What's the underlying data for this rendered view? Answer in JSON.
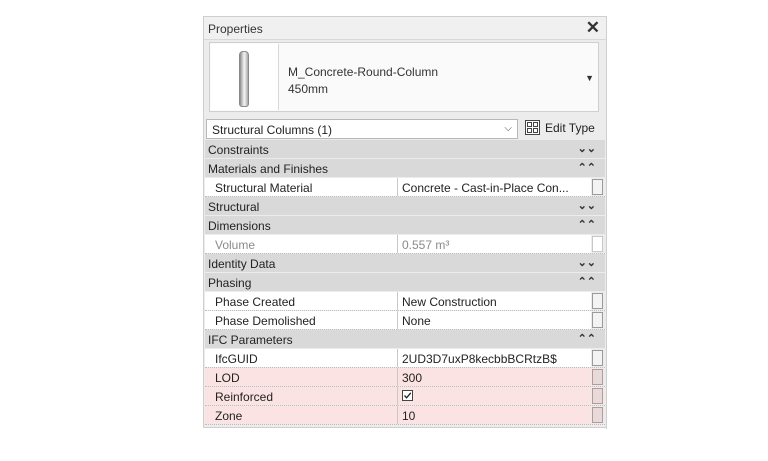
{
  "panel": {
    "title": "Properties",
    "close_glyph": "✕"
  },
  "type_selector": {
    "name": "M_Concrete-Round-Column",
    "size": "450mm",
    "dropdown_glyph": "▼",
    "thumbnail_icon": "round-column-preview-icon"
  },
  "category": {
    "label": "Structural Columns (1)",
    "chevron": "⌵"
  },
  "edit_type": {
    "label": "Edit Type",
    "icon": "edit-type-icon"
  },
  "rows": [
    {
      "kind": "group",
      "label": "Constraints",
      "toggle": "expand",
      "glyph": "⌄⌄"
    },
    {
      "kind": "group",
      "label": "Materials and Finishes",
      "toggle": "collapse",
      "glyph": "⌃⌃"
    },
    {
      "kind": "prop",
      "name": "Structural Material",
      "value": "Concrete - Cast-in-Place Con...",
      "editable": true
    },
    {
      "kind": "group",
      "label": "Structural",
      "toggle": "expand",
      "glyph": "⌄⌄"
    },
    {
      "kind": "group",
      "label": "Dimensions",
      "toggle": "collapse",
      "glyph": "⌃⌃"
    },
    {
      "kind": "prop",
      "name": "Volume",
      "value": "0.557 m³",
      "greyed": true
    },
    {
      "kind": "group",
      "label": "Identity Data",
      "toggle": "expand",
      "glyph": "⌄⌄"
    },
    {
      "kind": "group",
      "label": "Phasing",
      "toggle": "collapse",
      "glyph": "⌃⌃"
    },
    {
      "kind": "prop",
      "name": "Phase Created",
      "value": "New Construction"
    },
    {
      "kind": "prop",
      "name": "Phase Demolished",
      "value": "None"
    },
    {
      "kind": "group",
      "label": "IFC Parameters",
      "toggle": "collapse",
      "glyph": "⌃⌃"
    },
    {
      "kind": "prop",
      "name": "IfcGUID",
      "value": "2UD3D7uxP8kecbbBCRtzB$"
    },
    {
      "kind": "prop",
      "name": "LOD",
      "value": "300",
      "highlight": true
    },
    {
      "kind": "prop",
      "name": "Reinforced",
      "checkbox": true,
      "checked": true,
      "highlight": true
    },
    {
      "kind": "prop",
      "name": "Zone",
      "value": "10",
      "highlight": true
    }
  ],
  "colors": {
    "group_bg": "#d9d9d9",
    "highlight_bg": "#fbe3e3",
    "panel_bg": "#ececec"
  }
}
